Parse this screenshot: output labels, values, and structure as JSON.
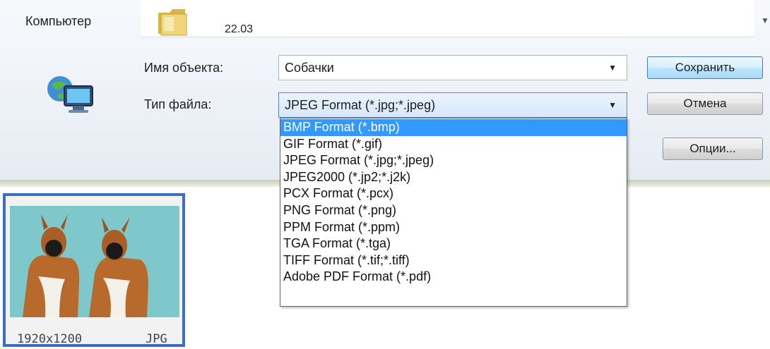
{
  "nav": {
    "computer_label": "Компьютер"
  },
  "folder": {
    "label": "22.03"
  },
  "form": {
    "name_label": "Имя объекта:",
    "name_value": "Собачки",
    "type_label": "Тип файла:",
    "type_value": "JPEG Format (*.jpg;*.jpeg)"
  },
  "buttons": {
    "save": "Сохранить",
    "cancel": "Отмена",
    "options": "Опции..."
  },
  "dropdown": {
    "selected_index": 0,
    "items": [
      "BMP Format (*.bmp)",
      "GIF Format (*.gif)",
      "JPEG Format (*.jpg;*.jpeg)",
      "JPEG2000 (*.jp2;*.j2k)",
      "PCX Format (*.pcx)",
      "PNG Format (*.png)",
      "PPM Format (*.ppm)",
      "TGA Format (*.tga)",
      "TIFF Format (*.tif;*.tiff)",
      "Adobe PDF Format (*.pdf)"
    ]
  },
  "thumbnail": {
    "dimensions": "1920x1200",
    "type": "JPG"
  },
  "colors": {
    "selection": "#3399ff",
    "thumb_border": "#3b6ec8",
    "default_button": "#bee6fd"
  }
}
